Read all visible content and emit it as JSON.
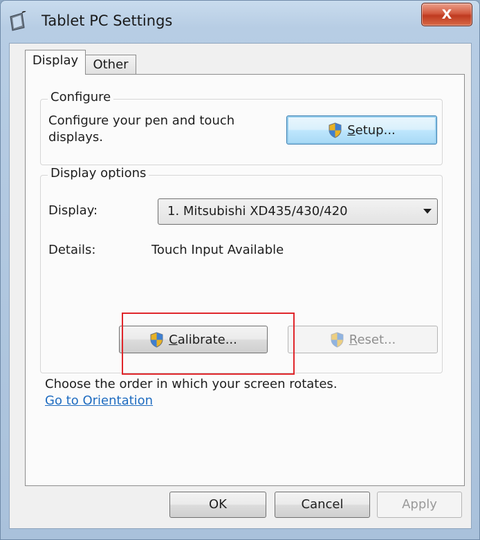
{
  "window": {
    "title": "Tablet PC Settings",
    "close_label": "X"
  },
  "tabs": [
    {
      "label": "Display",
      "selected": true
    },
    {
      "label": "Other",
      "selected": false
    }
  ],
  "configure": {
    "group_title": "Configure",
    "description_line1": "Configure your pen and touch",
    "description_line2": "displays.",
    "setup_button": {
      "mnemonic": "S",
      "rest": "etup..."
    }
  },
  "display_options": {
    "group_title": "Display options",
    "display_label": "Display:",
    "display_value": "1. Mitsubishi XD435/430/420",
    "details_label": "Details:",
    "details_value": "Touch Input Available",
    "calibrate_button": {
      "mnemonic": "C",
      "rest": "alibrate..."
    },
    "reset_button": {
      "mnemonic": "R",
      "rest": "eset...",
      "enabled": false
    }
  },
  "orientation": {
    "text": "Choose the order in which your screen rotates.",
    "link": "Go to Orientation"
  },
  "footer": {
    "ok": "OK",
    "cancel": "Cancel",
    "apply": "Apply"
  },
  "colors": {
    "highlight_box": "#e0262b",
    "link": "#1f6cc0",
    "close_button": "#c9452a"
  },
  "icons": [
    "tablet-pc-icon",
    "uac-shield-icon",
    "dropdown-arrow-icon",
    "close-icon"
  ]
}
